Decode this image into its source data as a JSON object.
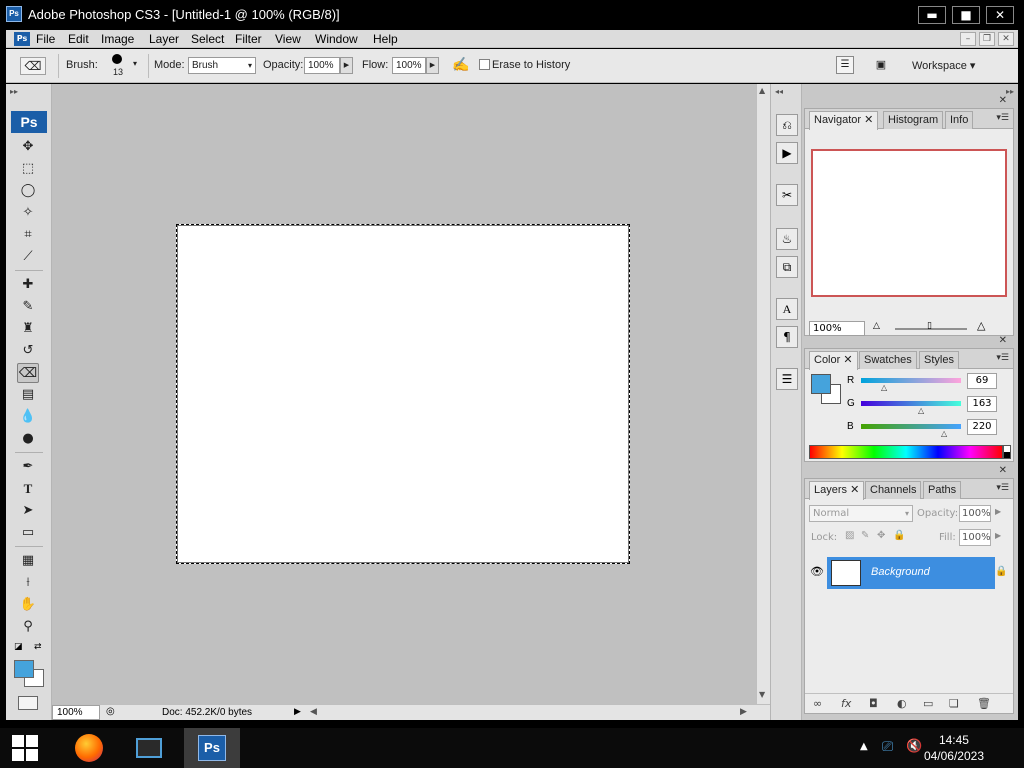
{
  "window": {
    "icon_text": "Ps",
    "title": "Adobe Photoshop CS3 - [Untitled-1 @ 100% (RGB/8)]",
    "minimize": "▬",
    "maximize": "■",
    "close": "✕"
  },
  "menu": {
    "icon_text": "Ps",
    "items": [
      "File",
      "Edit",
      "Image",
      "Layer",
      "Select",
      "Filter",
      "View",
      "Window",
      "Help"
    ],
    "doc_minimize": "–",
    "doc_restore": "❐",
    "doc_close": "✕"
  },
  "options": {
    "brush_label": "Brush:",
    "brush_size": "13",
    "mode_label": "Mode:",
    "mode_value": "Brush",
    "opacity_label": "Opacity:",
    "opacity_value": "100%",
    "flow_label": "Flow:",
    "flow_value": "100%",
    "erase_history_label": "Erase to History",
    "workspace_label": "Workspace ▾"
  },
  "toolbox": {
    "logo": "Ps",
    "active_tool": "eraser"
  },
  "canvas": {
    "background": "#c0c0c0",
    "document_color": "#ffffff"
  },
  "status": {
    "zoom": "100%",
    "doc_info": "Doc: 452.2K/0 bytes"
  },
  "navigator": {
    "tabs": [
      "Navigator",
      "Histogram",
      "Info"
    ],
    "zoom": "100%"
  },
  "color": {
    "tabs": [
      "Color",
      "Swatches",
      "Styles"
    ],
    "foreground": "#45a3dc",
    "channels": [
      {
        "label": "R",
        "value": "69"
      },
      {
        "label": "G",
        "value": "163"
      },
      {
        "label": "B",
        "value": "220"
      }
    ]
  },
  "layers": {
    "tabs": [
      "Layers",
      "Channels",
      "Paths"
    ],
    "blend_mode": "Normal",
    "opacity_label": "Opacity:",
    "opacity_value": "100%",
    "lock_label": "Lock:",
    "fill_label": "Fill:",
    "fill_value": "100%",
    "items": [
      {
        "name": "Background",
        "locked": true,
        "visible": true
      }
    ]
  },
  "taskbar": {
    "time": "14:45",
    "date": "04/06/2023",
    "ps_label": "Ps"
  }
}
